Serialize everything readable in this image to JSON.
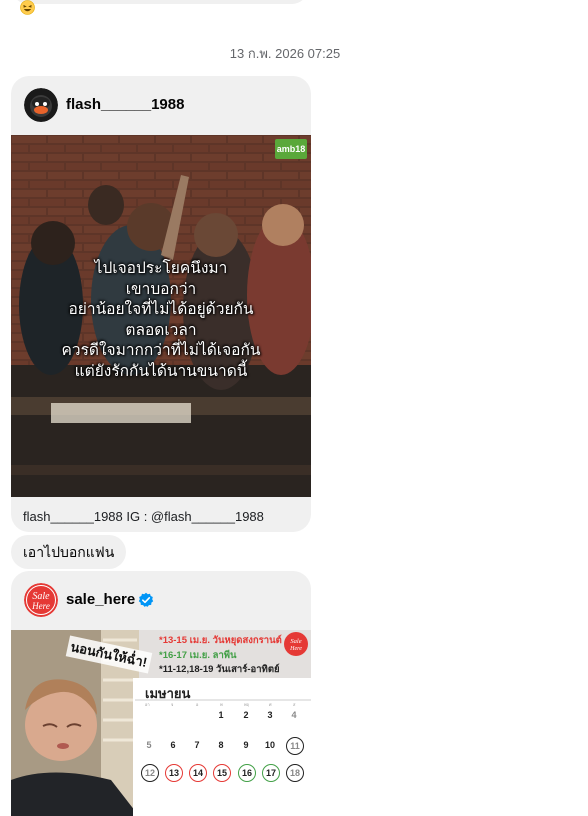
{
  "previous_message": {
    "emoji": "😆"
  },
  "timestamp": "13 ก.พ. 2026 07:25",
  "share1": {
    "username": "flash______1988",
    "watermark": "amb18",
    "overlay_lines": [
      "ไปเจอประโยคนึงมา",
      "เขาบอกว่า",
      "อย่าน้อยใจที่ไม่ได้อยู่ด้วยกัน",
      "ตลอดเวลา",
      "ควรดีใจมากกว่าที่ไม่ได้เจอกัน",
      "แต่ยังรักกันได้นานขนาดนี้"
    ],
    "caption": "flash______1988 IG : @flash______1988"
  },
  "text_message": "เอาไปบอกแฟน",
  "share2": {
    "username": "sale_here",
    "logo_text": [
      "Sale",
      "Here"
    ],
    "handwriting": "นอนกันให้ฉ่ำ!",
    "promo_lines": [
      {
        "text": "*13-15 เม.ย. วันหยุดสงกรานต์",
        "color": "#e53935"
      },
      {
        "text": "*16-17 เม.ย. ลาพีน",
        "color": "#43a047"
      },
      {
        "text": "*11-12,18-19 วันเสาร์-อาทิตย์",
        "color": "#222222"
      }
    ],
    "calendar_month": "เมษายน",
    "calendar_rows": [
      [
        "",
        "",
        "",
        "1",
        "2",
        "3",
        "4"
      ],
      [
        "5",
        "6",
        "7",
        "8",
        "9",
        "10",
        "11"
      ],
      [
        "12",
        "13",
        "14",
        "15",
        "16",
        "17",
        "18"
      ]
    ],
    "colors": {
      "red": "#e53935",
      "green": "#43a047",
      "weekend": "#222222"
    }
  }
}
